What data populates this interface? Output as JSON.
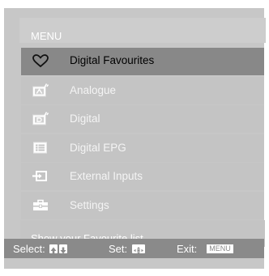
{
  "menu": {
    "title": "MENU",
    "items": [
      {
        "label": "Digital Favourites",
        "icon": "heart-icon",
        "selected": true
      },
      {
        "label": "Analogue",
        "icon": "analogue-tv-icon",
        "selected": false
      },
      {
        "label": "Digital",
        "icon": "digital-tv-icon",
        "selected": false
      },
      {
        "label": "Digital EPG",
        "icon": "epg-icon",
        "selected": false
      },
      {
        "label": "External Inputs",
        "icon": "external-input-icon",
        "selected": false
      },
      {
        "label": "Settings",
        "icon": "toolbox-icon",
        "selected": false
      }
    ],
    "help_text": "Show your Favourite list"
  },
  "footer": {
    "select_label": "Select:",
    "set_label": "Set:",
    "exit_label": "Exit:",
    "menu_key": "MENU"
  },
  "colors": {
    "panel": "#c7c7c7",
    "selected_row": "#888888",
    "footer": "#8a8a8a",
    "text": "#ffffff"
  }
}
